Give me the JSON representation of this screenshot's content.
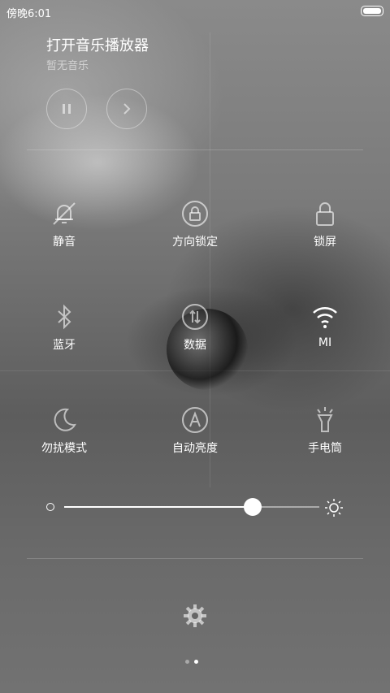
{
  "status_bar": {
    "time": "傍晚6:01"
  },
  "music": {
    "title": "打开音乐播放器",
    "subtitle": "暂无音乐",
    "pause_icon": "pause-icon",
    "next_icon": "chevron-right-icon"
  },
  "toggles": [
    {
      "label": "静音",
      "icon": "bell-off-icon",
      "active": false
    },
    {
      "label": "方向锁定",
      "icon": "rotation-lock-icon",
      "active": false
    },
    {
      "label": "锁屏",
      "icon": "lock-icon",
      "active": false
    },
    {
      "label": "蓝牙",
      "icon": "bluetooth-icon",
      "active": false
    },
    {
      "label": "数据",
      "icon": "mobile-data-icon",
      "active": false
    },
    {
      "label": "MI",
      "icon": "wifi-icon",
      "active": true
    },
    {
      "label": "勿扰模式",
      "icon": "moon-icon",
      "active": false
    },
    {
      "label": "自动亮度",
      "icon": "auto-brightness-icon",
      "active": false
    },
    {
      "label": "手电筒",
      "icon": "flashlight-icon",
      "active": false
    }
  ],
  "brightness": {
    "level": 0.74
  },
  "pager": {
    "pages": 2,
    "current": 2
  }
}
